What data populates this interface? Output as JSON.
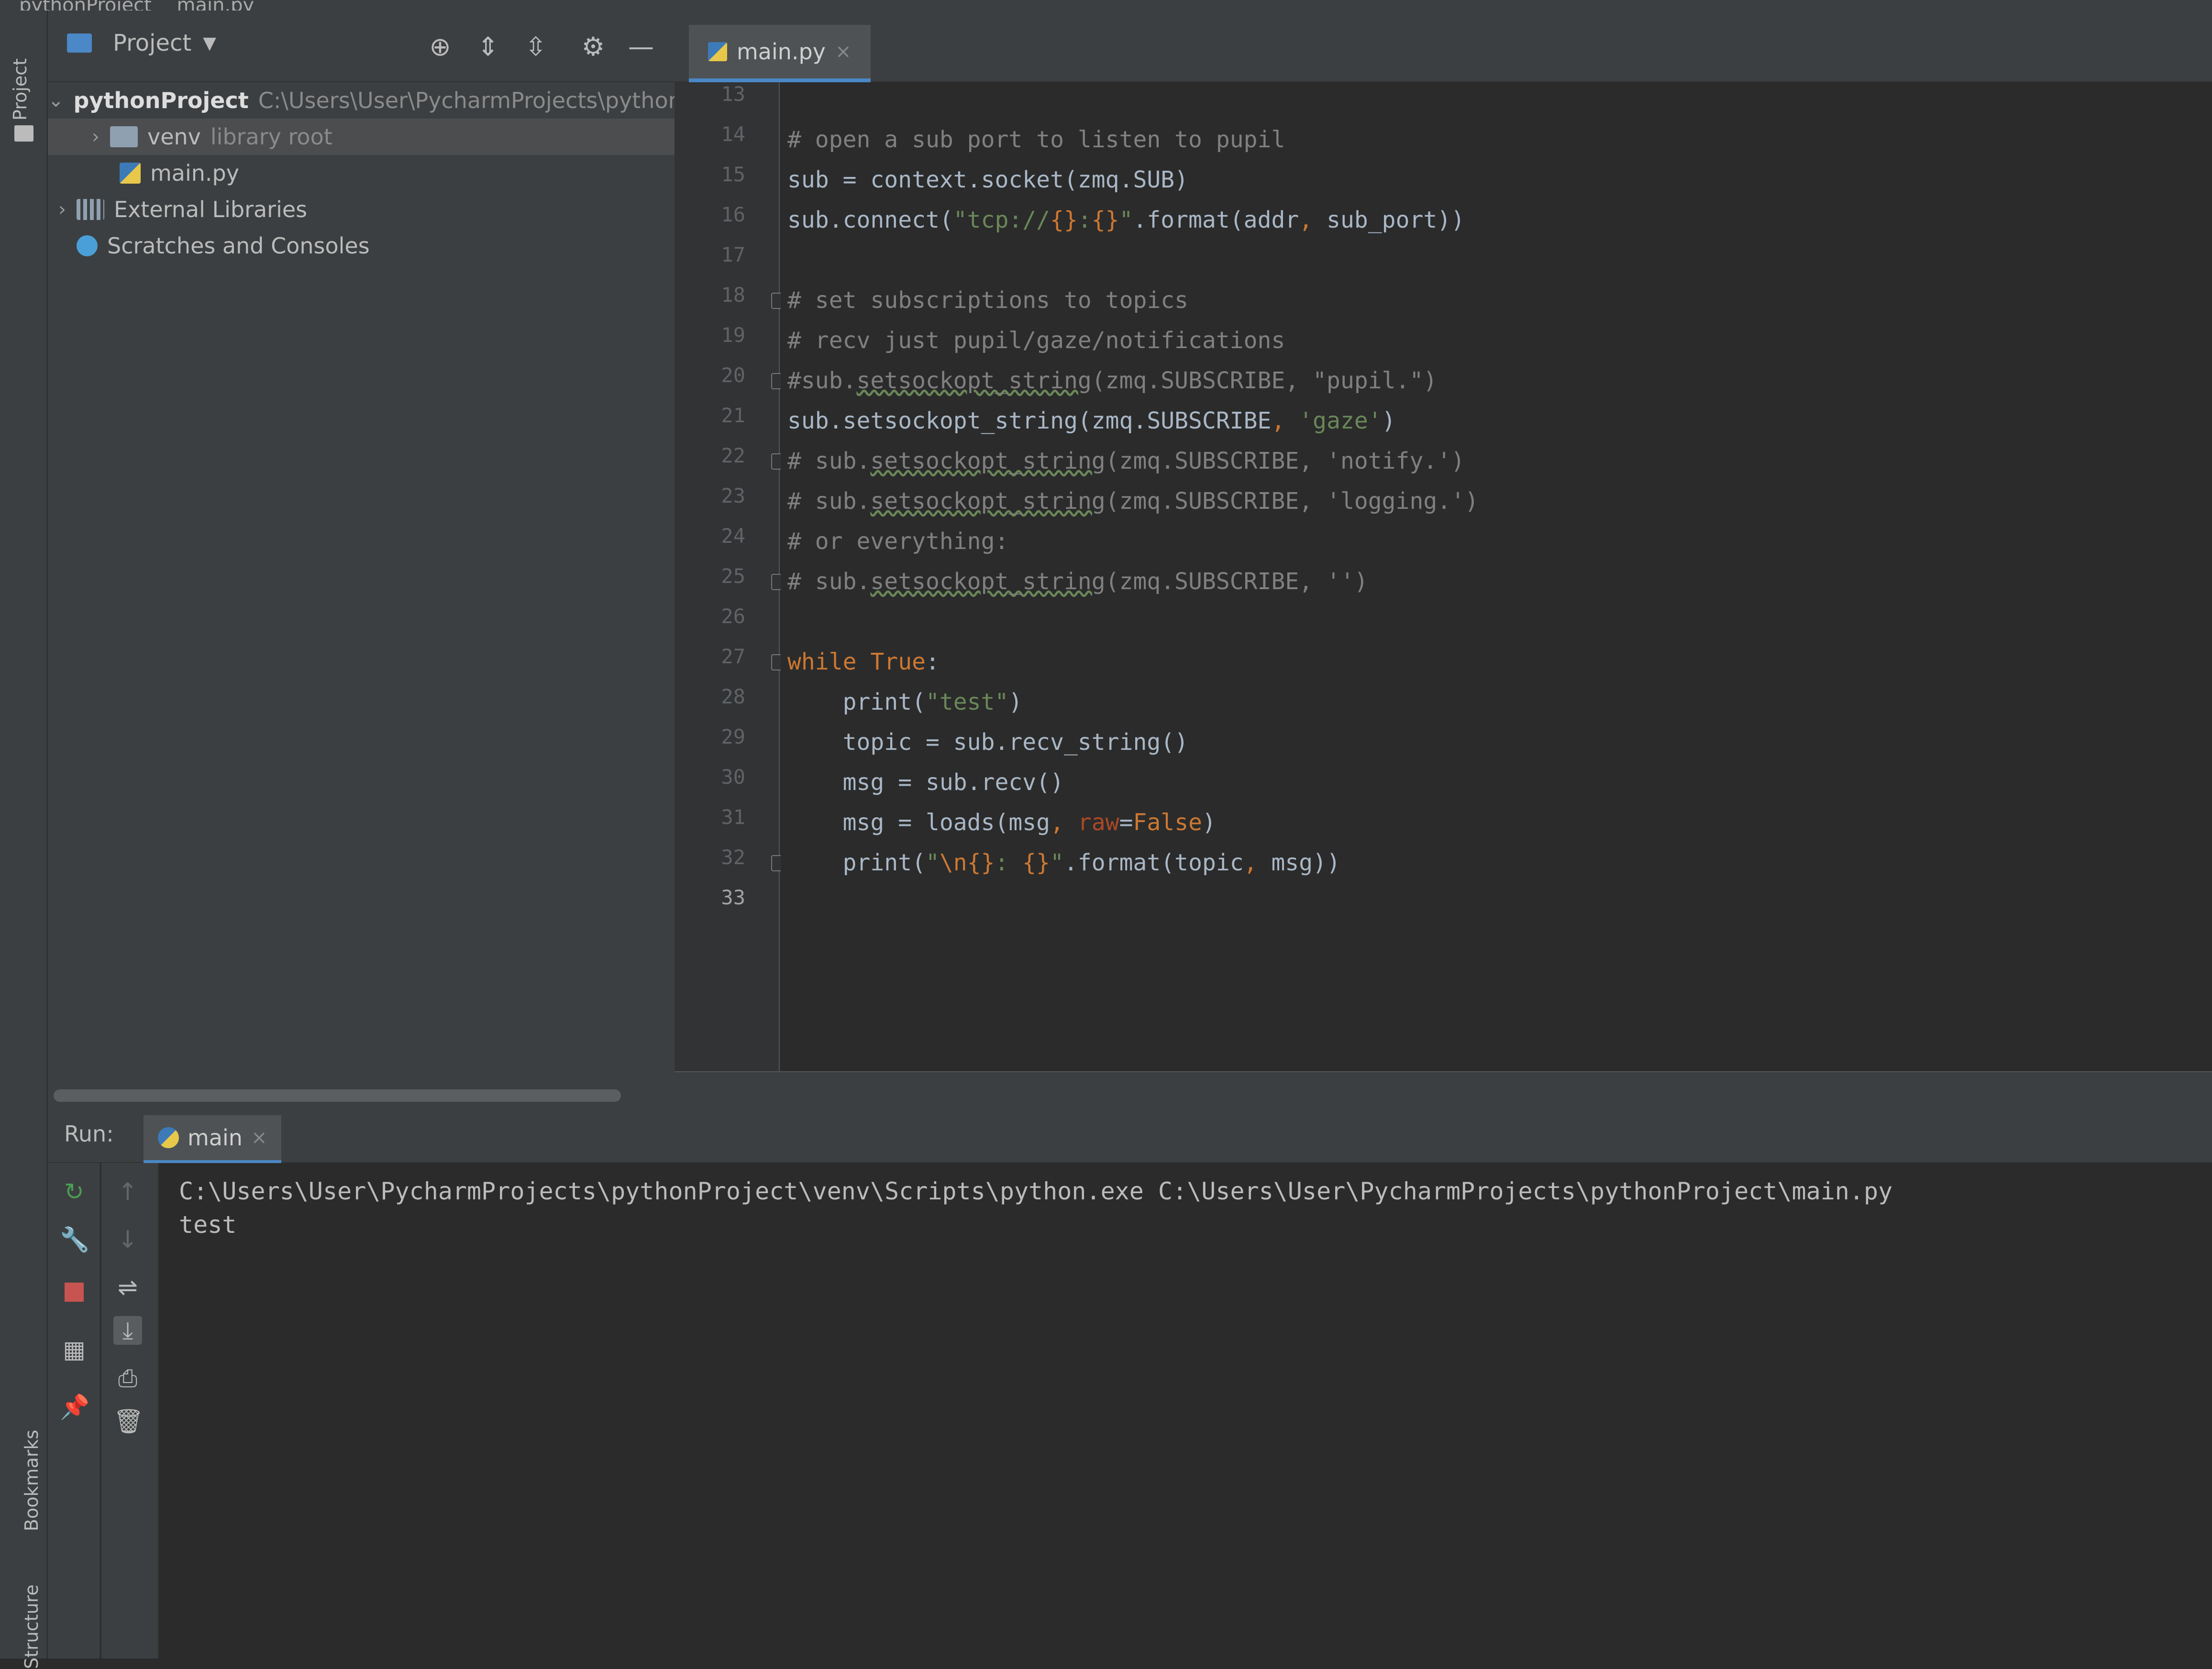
{
  "titlebar": {
    "project": "pythonProject",
    "file": "main.py"
  },
  "stripe": {
    "project_label": "Project",
    "bookmarks_label": "Bookmarks",
    "structure_label": "Structure"
  },
  "project_panel": {
    "title": "Project",
    "tree": [
      {
        "label": "pythonProject",
        "note": "C:\\Users\\User\\PycharmProjects\\pythonPr"
      },
      {
        "label": "venv",
        "note": "library root"
      },
      {
        "label": "main.py",
        "note": ""
      },
      {
        "label": "External Libraries",
        "note": ""
      },
      {
        "label": "Scratches and Consoles",
        "note": ""
      }
    ]
  },
  "editor": {
    "tab_label": "main.py",
    "line_numbers": [
      "13",
      "14",
      "15",
      "16",
      "17",
      "18",
      "19",
      "20",
      "21",
      "22",
      "23",
      "24",
      "25",
      "26",
      "27",
      "28",
      "29",
      "30",
      "31",
      "32",
      "33"
    ],
    "lines": [
      "",
      "# open a sub port to listen to pupil",
      "sub = context.socket(zmq.SUB)",
      "sub.connect(\"tcp://{}:{}\".format(addr, sub_port))",
      "",
      "# set subscriptions to topics",
      "# recv just pupil/gaze/notifications",
      "#sub.setsockopt_string(zmq.SUBSCRIBE, \"pupil.\")",
      "sub.setsockopt_string(zmq.SUBSCRIBE, 'gaze')",
      "# sub.setsockopt_string(zmq.SUBSCRIBE, 'notify.')",
      "# sub.setsockopt_string(zmq.SUBSCRIBE, 'logging.')",
      "# or everything:",
      "# sub.setsockopt_string(zmq.SUBSCRIBE, '')",
      "",
      "while True:",
      "    print(\"test\")",
      "    topic = sub.recv_string()",
      "    msg = sub.recv()",
      "    msg = loads(msg, raw=False)",
      "    print(\"\\n{}: {}\".format(topic, msg))",
      ""
    ]
  },
  "run": {
    "label": "Run:",
    "tab_label": "main",
    "output": [
      "C:\\Users\\User\\PycharmProjects\\pythonProject\\venv\\Scripts\\python.exe C:\\Users\\User\\PycharmProjects\\pythonProject\\main.py",
      "test"
    ]
  },
  "icons": [
    "folder-icon",
    "python-file-icon",
    "library-icon",
    "scratches-icon",
    "locate-icon",
    "expand-all-icon",
    "collapse-all-icon",
    "gear-icon",
    "hide-icon",
    "rerun-icon",
    "wrench-icon",
    "stop-icon",
    "layout-icon",
    "pin-icon",
    "up-arrow-icon",
    "down-arrow-icon",
    "soft-wrap-icon",
    "scroll-to-end-icon",
    "print-icon",
    "trash-icon"
  ],
  "colors": {
    "keyword": "#cc7832",
    "string": "#6a8759",
    "comment": "#808080",
    "default": "#a9b7c6",
    "param": "#aa4926",
    "stop": "#c75450",
    "rerun": "#499c54"
  }
}
